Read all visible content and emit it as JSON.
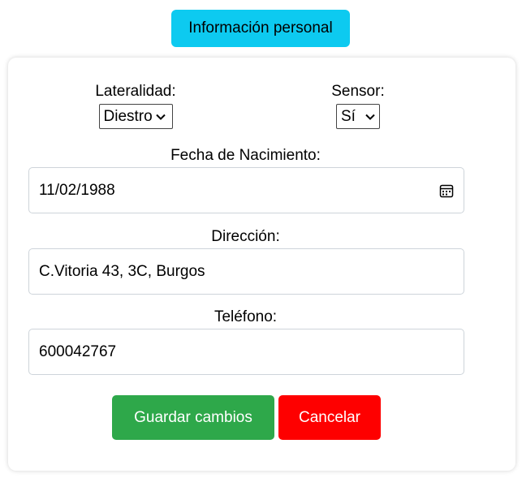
{
  "header": {
    "title": "Información personal"
  },
  "form": {
    "laterality": {
      "label": "Lateralidad:",
      "value": "Diestro"
    },
    "sensor": {
      "label": "Sensor:",
      "value": "Sí"
    },
    "birthdate": {
      "label": "Fecha de Nacimiento:",
      "value": "11/02/1988"
    },
    "address": {
      "label": "Dirección:",
      "value": "C.Vitoria 43, 3C, Burgos"
    },
    "phone": {
      "label": "Teléfono:",
      "value": "600042767"
    }
  },
  "actions": {
    "save_label": "Guardar cambios",
    "cancel_label": "Cancelar"
  },
  "colors": {
    "header_bg": "#0dcaf0",
    "save_bg": "#2ea84a",
    "cancel_bg": "#fe0000"
  },
  "icons": {
    "calendar": "calendar-icon",
    "dropdown": "chevron-down-icon"
  }
}
